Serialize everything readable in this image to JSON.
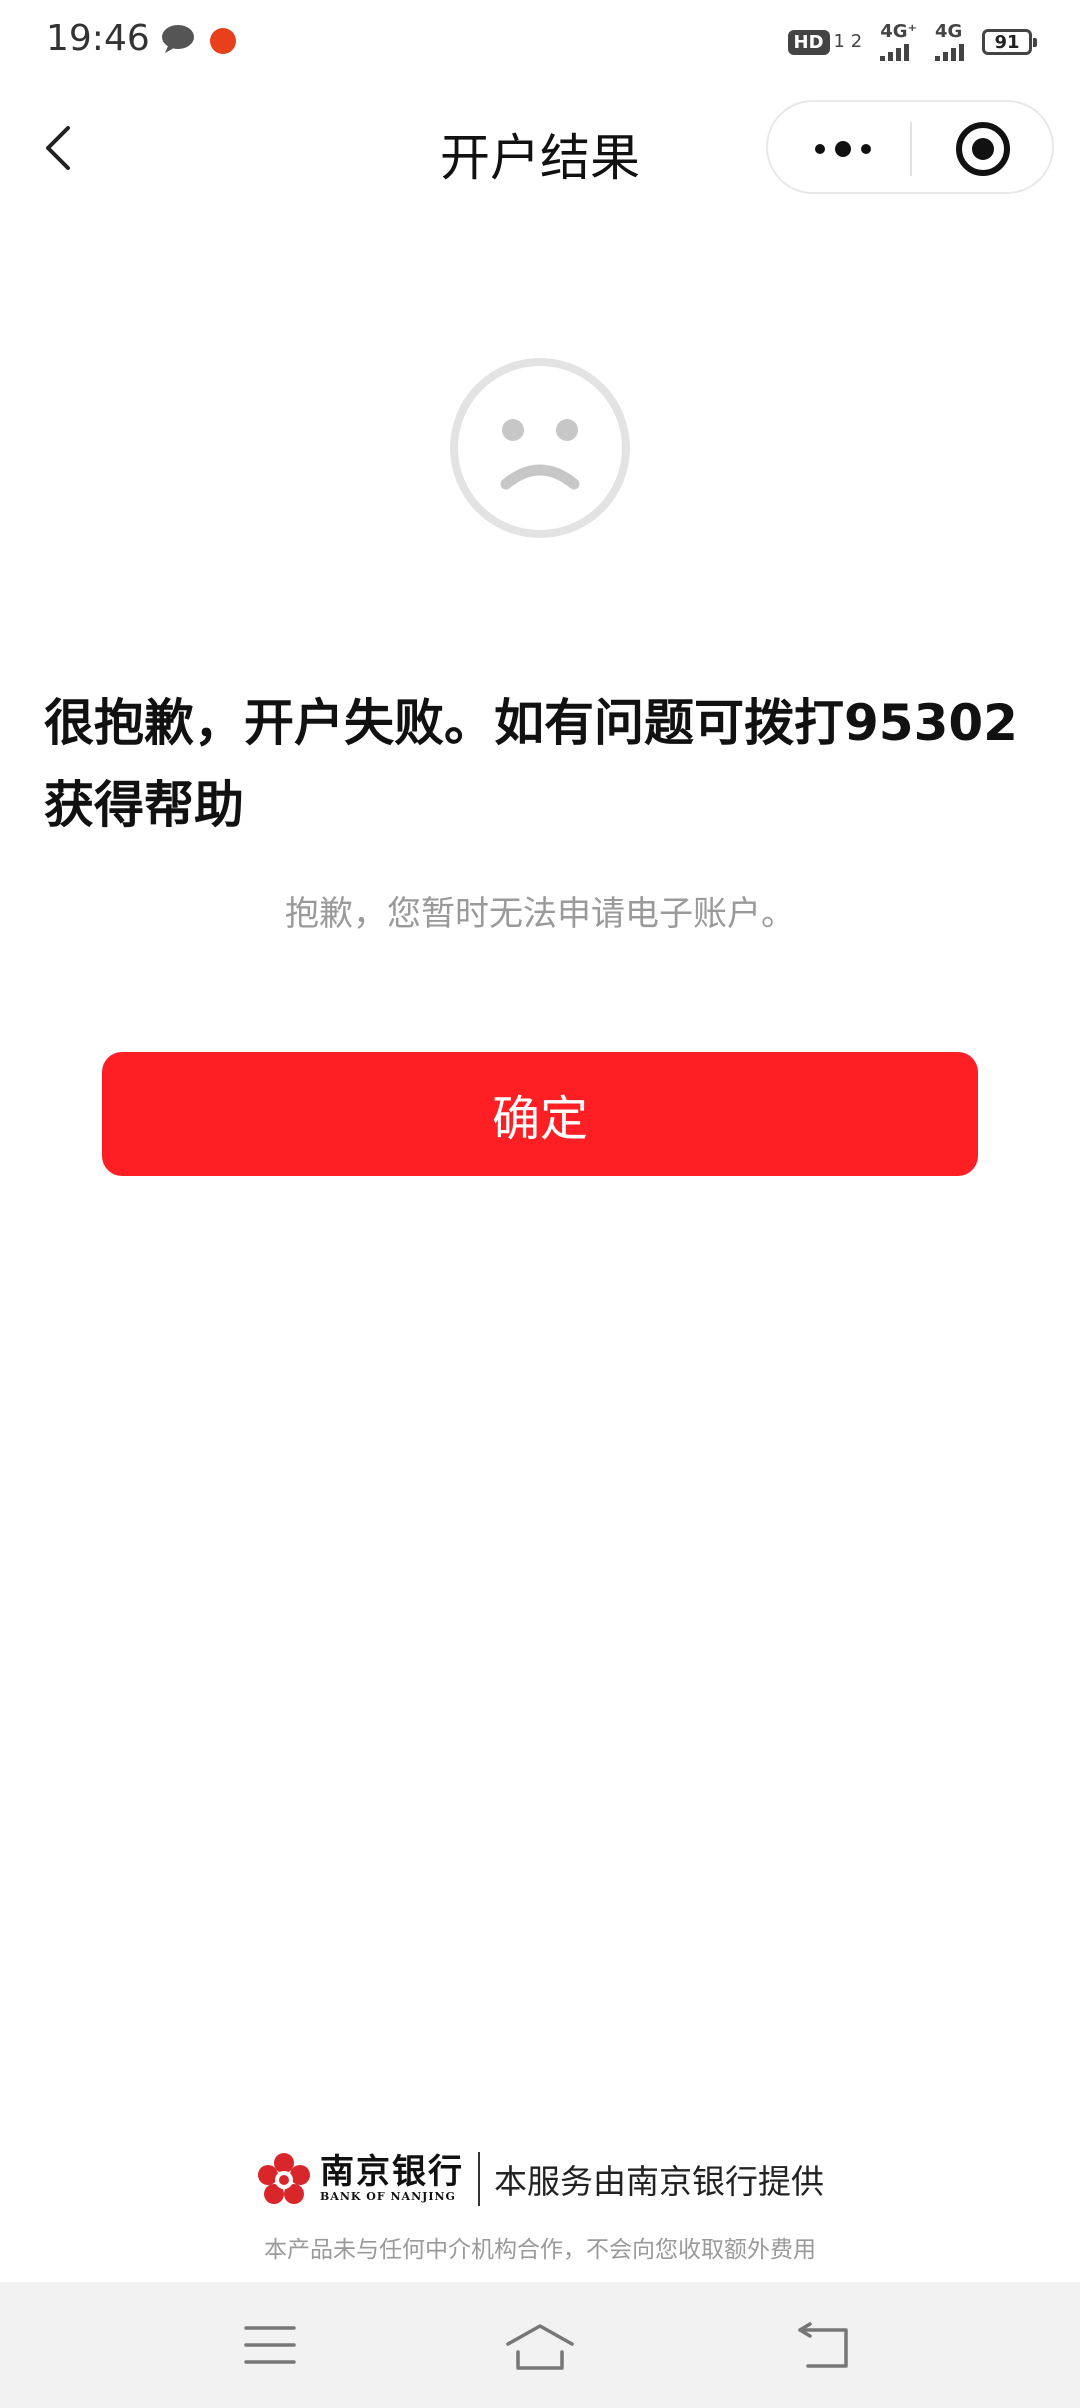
{
  "status_bar": {
    "time": "19:46",
    "hd_label": "HD",
    "hd_sim": "1 2",
    "signal1_label": "4G⁺",
    "signal2_label": "4G",
    "battery": "91"
  },
  "nav": {
    "title": "开户结果"
  },
  "result": {
    "title": "很抱歉，开户失败。如有问题可拨打95302获得帮助",
    "subtitle": "抱歉，您暂时无法申请电子账户。"
  },
  "confirm_button_label": "确定",
  "footer": {
    "bank_name": "南京银行",
    "bank_name_en": "BANK OF NANJING",
    "provider_text": "本服务由南京银行提供",
    "disclaimer": "本产品未与任何中介机构合作，不会向您收取额外费用"
  },
  "colors": {
    "accent": "#fe1f24",
    "sub_text": "#9a9a9a"
  },
  "icons": [
    "chat-icon",
    "app-notification-icon",
    "back-icon",
    "more-icon",
    "target-icon",
    "sad-face-icon",
    "bank-logo-icon",
    "menu-icon",
    "home-icon",
    "return-icon"
  ]
}
